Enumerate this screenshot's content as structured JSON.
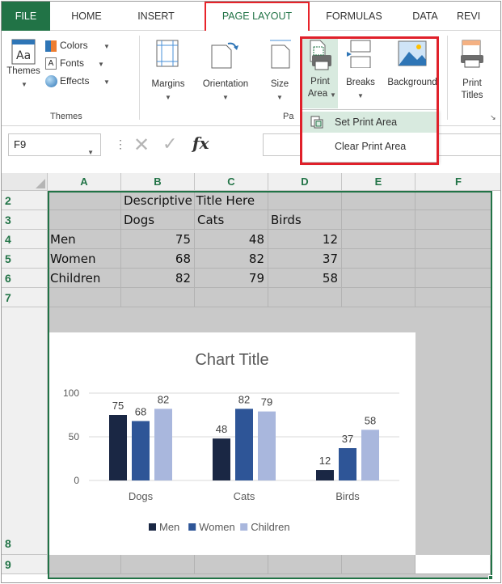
{
  "ribbon_tabs": [
    {
      "label": "FILE"
    },
    {
      "label": "HOME"
    },
    {
      "label": "INSERT"
    },
    {
      "label": "PAGE LAYOUT"
    },
    {
      "label": "FORMULAS"
    },
    {
      "label": "DATA"
    },
    {
      "label": "REVI"
    }
  ],
  "themes_group": {
    "themes_label": "Themes",
    "colors_label": "Colors",
    "fonts_label": "Fonts",
    "effects_label": "Effects",
    "caption": "Themes"
  },
  "page_setup": {
    "margins_label": "Margins",
    "orientation_label": "Orientation",
    "size_label": "Size",
    "print_area_line1": "Print",
    "print_area_line2": "Area",
    "breaks_label": "Breaks",
    "background_label": "Background",
    "print_titles_line1": "Print",
    "print_titles_line2": "Titles",
    "caption_partial": "Pa"
  },
  "print_area_menu": {
    "set_label": "Set Print Area",
    "clear_label": "Clear Print Area"
  },
  "formula_bar": {
    "name_box": "F9",
    "fx_label": "fx"
  },
  "columns": [
    "A",
    "B",
    "C",
    "D",
    "E",
    "F"
  ],
  "rows": [
    "2",
    "3",
    "4",
    "5",
    "6",
    "7",
    "8",
    "9"
  ],
  "sheet": {
    "title": "Descriptive Title Here",
    "headers": [
      "Dogs",
      "Cats",
      "Birds"
    ],
    "table": [
      {
        "label": "Men",
        "values": [
          "75",
          "48",
          "12"
        ]
      },
      {
        "label": "Women",
        "values": [
          "68",
          "82",
          "37"
        ]
      },
      {
        "label": "Children",
        "values": [
          "82",
          "79",
          "58"
        ]
      }
    ]
  },
  "chart_data": {
    "type": "bar",
    "title": "Chart Title",
    "categories": [
      "Dogs",
      "Cats",
      "Birds"
    ],
    "series": [
      {
        "name": "Men",
        "values": [
          75,
          48,
          12
        ],
        "color": "#1a2744"
      },
      {
        "name": "Women",
        "values": [
          68,
          82,
          37
        ],
        "color": "#2e5597"
      },
      {
        "name": "Children",
        "values": [
          82,
          79,
          58
        ],
        "color": "#a9b7dd"
      }
    ],
    "yticks": [
      "0",
      "50",
      "100"
    ],
    "ylim": [
      0,
      100
    ],
    "grid": true,
    "legend_position": "bottom"
  },
  "colors": {
    "excel_green": "#217346",
    "highlight_red": "#e0202a",
    "selection_fill": "#c9c9c9"
  }
}
